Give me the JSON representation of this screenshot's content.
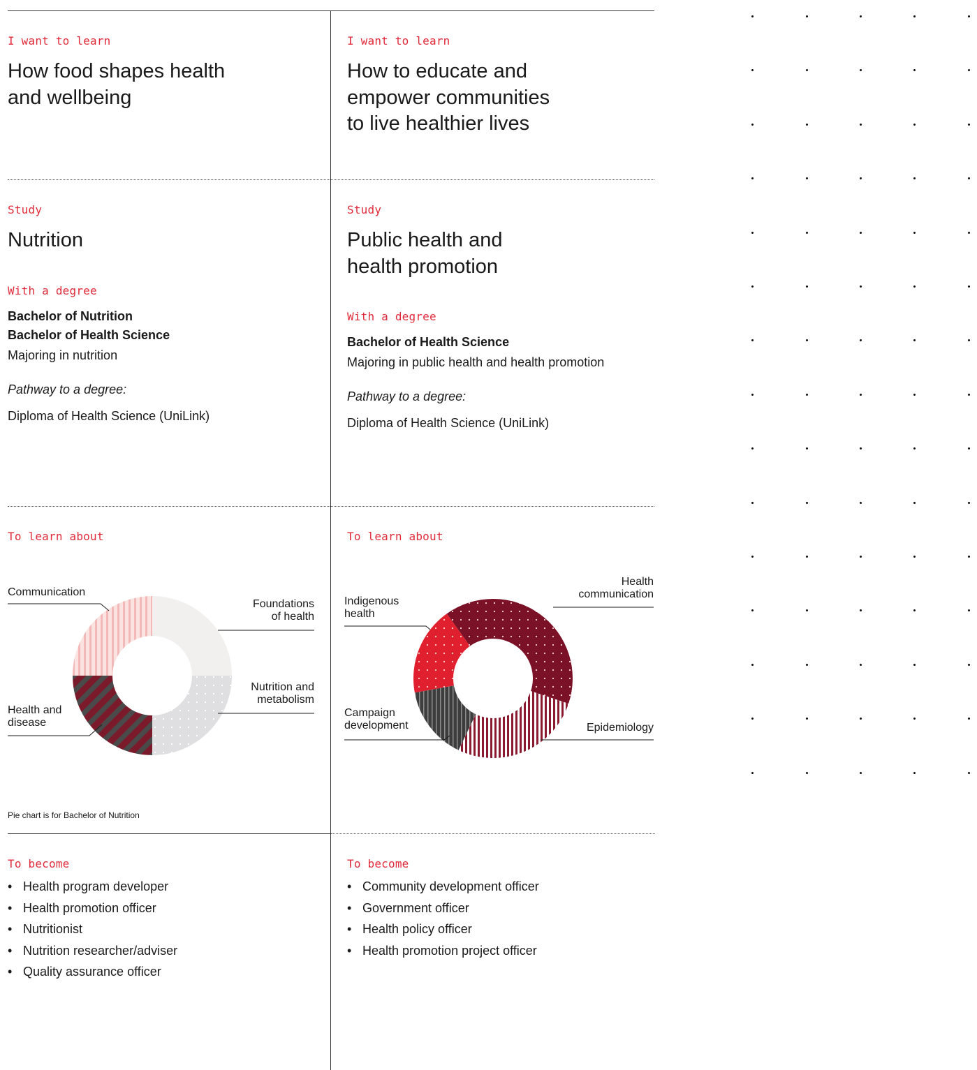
{
  "columns": [
    {
      "learn_label": "I want to learn",
      "learn_lines": [
        "How food shapes health",
        "and wellbeing"
      ],
      "study_label": "Study",
      "study_lines": [
        "Nutrition"
      ],
      "degree_label": "With a degree",
      "degrees_bold": [
        "Bachelor of Nutrition",
        "Bachelor of Health Science"
      ],
      "major": "Majoring in nutrition",
      "pathway_label": "Pathway to a degree:",
      "pathway": "Diploma of Health Science (UniLink)",
      "learn_about_label": "To learn about",
      "chart_note": "Pie chart is for Bachelor of Nutrition",
      "become_label": "To become",
      "careers": [
        "Health program developer",
        "Health promotion officer",
        "Nutritionist",
        "Nutrition researcher/adviser",
        "Quality assurance officer"
      ]
    },
    {
      "learn_label": "I want to learn",
      "learn_lines": [
        "How to educate and",
        "empower communities",
        "to live healthier lives"
      ],
      "study_label": "Study",
      "study_lines": [
        "Public health and",
        "health promotion"
      ],
      "degree_label": "With a degree",
      "degrees_bold": [
        "Bachelor of Health Science"
      ],
      "major": "Majoring in public health and health promotion",
      "pathway_label": "Pathway to a degree:",
      "pathway": "Diploma of Health Science (UniLink)",
      "learn_about_label": "To learn about",
      "become_label": "To become",
      "careers": [
        "Community development officer",
        "Government officer",
        "Health policy officer",
        "Health promotion project officer"
      ]
    }
  ],
  "chart_data": [
    {
      "type": "pie",
      "categories": [
        "Foundations of health",
        "Nutrition and metabolism",
        "Health and disease",
        "Communication"
      ],
      "values": [
        25,
        25,
        25,
        25
      ],
      "label_lines": [
        [
          "Foundations",
          "of health"
        ],
        [
          "Nutrition and",
          "metabolism"
        ],
        [
          "Health and",
          "disease"
        ],
        [
          "Communication"
        ]
      ],
      "colors": [
        "#f2f0ef",
        "#dfdfe1",
        "#7a1a2a",
        "#f6c9c9"
      ],
      "hole": 0.5,
      "legend": "none"
    },
    {
      "type": "pie",
      "categories": [
        "Health communication",
        "Epidemiology",
        "Campaign development",
        "Indigenous health"
      ],
      "values": [
        40,
        27,
        15,
        18
      ],
      "label_lines": [
        [
          "Health",
          "communication"
        ],
        [
          "Epidemiology"
        ],
        [
          "Campaign",
          "development"
        ],
        [
          "Indigenous",
          "health"
        ]
      ],
      "colors": [
        "#7a1127",
        "#8a1a30",
        "#4a4a4a",
        "#e0202e"
      ],
      "hole": 0.5,
      "legend": "none"
    }
  ]
}
